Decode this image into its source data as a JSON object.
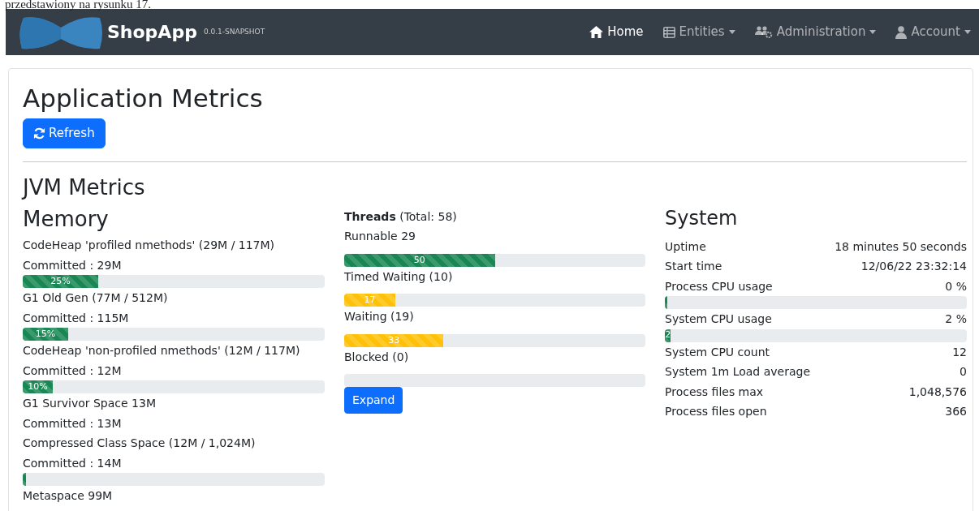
{
  "document_text": "przedstawiony na rysunku 17.",
  "navbar": {
    "brand": "ShopApp",
    "version": "0.0.1-SNAPSHOT",
    "items": [
      {
        "label": "Home",
        "dropdown": false,
        "selected": true
      },
      {
        "label": "Entities",
        "dropdown": true,
        "selected": false
      },
      {
        "label": "Administration",
        "dropdown": true,
        "selected": false
      },
      {
        "label": "Account",
        "dropdown": true,
        "selected": false
      }
    ]
  },
  "title": "Application Metrics",
  "refresh_button": "Refresh",
  "jvm_title": "JVM Metrics",
  "memory": {
    "title": "Memory",
    "items": [
      {
        "name": "CodeHeap 'profiled nmethods' (29M / 117M)",
        "committed": "Committed : 29M",
        "bar": {
          "level": 0.25,
          "text": "25%"
        }
      },
      {
        "name": "G1 Old Gen (77M / 512M)",
        "committed": "Committed : 115M",
        "bar": {
          "level": 0.15,
          "text": "15%"
        }
      },
      {
        "name": "CodeHeap 'non-profiled nmethods' (12M / 117M)",
        "committed": "Committed : 12M",
        "bar": {
          "level": 0.1,
          "text": "10%"
        }
      },
      {
        "name": "G1 Survivor Space 13M",
        "committed": "Committed : 13M"
      },
      {
        "name": "Compressed Class Space (12M / 1,024M)",
        "committed": "Committed : 14M",
        "bar": {
          "level": 0.01
        }
      },
      {
        "name": "Metaspace 99M"
      }
    ]
  },
  "threads": {
    "title": "Threads",
    "total": "(Total: 58)",
    "items": [
      {
        "label": "Runnable 29",
        "bar": {
          "level": 0.5,
          "text": "50",
          "color": "#198754"
        }
      },
      {
        "label": "Timed Waiting (10)",
        "bar": {
          "level": 0.17,
          "text": "17",
          "color": "#ffc107"
        }
      },
      {
        "label": "Waiting (19)",
        "bar": {
          "level": 0.33,
          "text": "33",
          "color": "#ffc107"
        }
      },
      {
        "label": "Blocked (0)",
        "bar": {
          "level": 0
        }
      }
    ],
    "expand_button": "Expand"
  },
  "system": {
    "title": "System",
    "rows": [
      {
        "label": "Uptime",
        "value": "18 minutes 50 seconds"
      },
      {
        "label": "Start time",
        "value": "12/06/22 23:32:14"
      },
      {
        "label": "Process CPU usage",
        "value": "0 %",
        "bar": {
          "level": 0.003
        }
      },
      {
        "label": "System CPU usage",
        "value": "2 %",
        "bar": {
          "level": 0.02,
          "text": "2"
        }
      },
      {
        "label": "System CPU count",
        "value": "12"
      },
      {
        "label": "System 1m Load average",
        "value": "0"
      },
      {
        "label": "Process files max",
        "value": "1,048,576"
      },
      {
        "label": "Process files open",
        "value": "366"
      }
    ]
  }
}
